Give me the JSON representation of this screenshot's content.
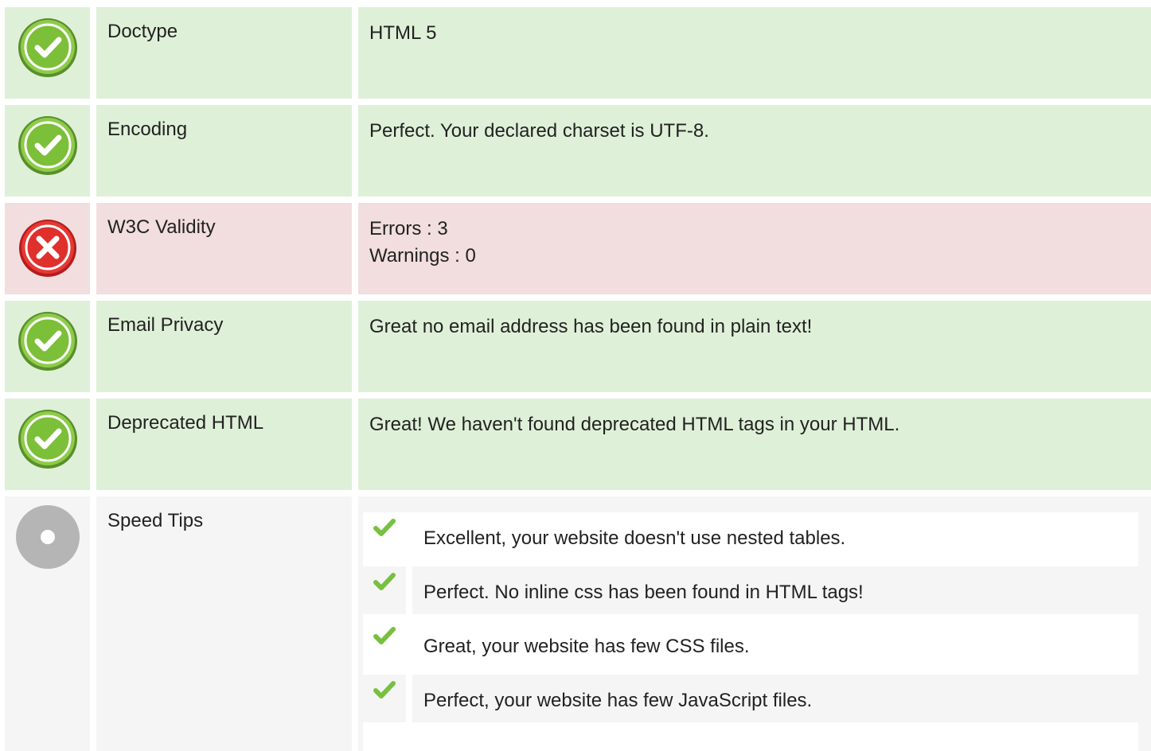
{
  "rows": [
    {
      "status": "ok",
      "label": "Doctype",
      "lines": [
        "HTML 5"
      ]
    },
    {
      "status": "ok",
      "label": "Encoding",
      "lines": [
        "Perfect. Your declared charset is UTF-8."
      ]
    },
    {
      "status": "error",
      "label": "W3C Validity",
      "lines": [
        "Errors : 3",
        "Warnings : 0"
      ]
    },
    {
      "status": "ok",
      "label": "Email Privacy",
      "lines": [
        "Great no email address has been found in plain text!"
      ]
    },
    {
      "status": "ok",
      "label": "Deprecated HTML",
      "lines": [
        "Great! We haven't found deprecated HTML tags in your HTML."
      ]
    }
  ],
  "speed": {
    "status": "neutral",
    "label": "Speed Tips",
    "tips": [
      "Excellent, your website doesn't use nested tables.",
      "Perfect. No inline css has been found in HTML tags!",
      "Great, your website has few CSS files.",
      "Perfect, your website has few JavaScript files."
    ]
  },
  "colors": {
    "ok_bg": "#dff0d8",
    "error_bg": "#f2dede",
    "neutral_bg": "#f5f5f5",
    "ok_icon": "#7dc242",
    "error_icon": "#e53935",
    "neutral_icon": "#b0b0b0",
    "tip_check": "#78c03f"
  },
  "icons": {
    "ok": "check-circle-icon",
    "error": "x-circle-icon",
    "neutral": "neutral-circle-icon",
    "tip": "checkmark-icon"
  }
}
